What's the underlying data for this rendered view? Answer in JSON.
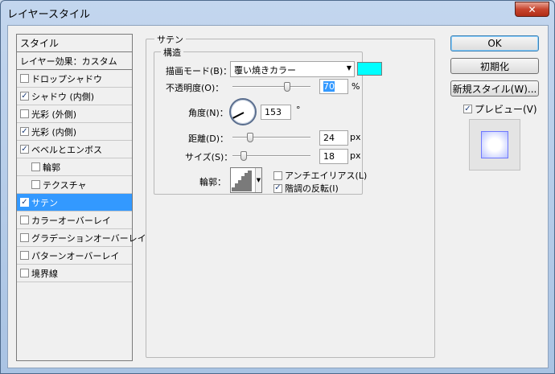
{
  "window": {
    "title": "レイヤースタイル",
    "close_glyph": "✕"
  },
  "list": {
    "header": "スタイル",
    "blend_options": "レイヤー効果：カスタム",
    "items": [
      {
        "label": "ドロップシャドウ",
        "checked": false
      },
      {
        "label": "シャドウ (内側)",
        "checked": true
      },
      {
        "label": "光彩 (外側)",
        "checked": false
      },
      {
        "label": "光彩 (内側)",
        "checked": true
      },
      {
        "label": "ベベルとエンボス",
        "checked": true
      },
      {
        "label": "輪郭",
        "checked": false
      },
      {
        "label": "テクスチャ",
        "checked": false
      },
      {
        "label": "サテン",
        "checked": true,
        "selected": true
      },
      {
        "label": "カラーオーバーレイ",
        "checked": false
      },
      {
        "label": "グラデーションオーバーレイ",
        "checked": false
      },
      {
        "label": "パターンオーバーレイ",
        "checked": false
      },
      {
        "label": "境界線",
        "checked": false
      }
    ],
    "check_glyph": "✓"
  },
  "satin": {
    "group_title": "サテン",
    "structure_title": "構造",
    "blend_mode_label": "描画モード(B)：",
    "blend_mode_value": "覆い焼きカラー",
    "blend_color": "#00ffff",
    "opacity_label": "不透明度(O)：",
    "opacity_value": "70",
    "opacity_unit": "%",
    "angle_label": "角度(N)：",
    "angle_value": "153",
    "angle_unit": "°",
    "distance_label": "距離(D)：",
    "distance_value": "24",
    "distance_unit": "px",
    "size_label": "サイズ(S)：",
    "size_value": "18",
    "size_unit": "px",
    "contour_label": "輪郭：",
    "antialias_label": "アンチエイリアス(L)",
    "antialias_checked": false,
    "invert_label": "階調の反転(I)",
    "invert_checked": true
  },
  "buttons": {
    "ok": "OK",
    "reset": "初期化",
    "new_style": "新規スタイル(W)...",
    "preview_label": "プレビュー(V)",
    "preview_checked": true
  }
}
